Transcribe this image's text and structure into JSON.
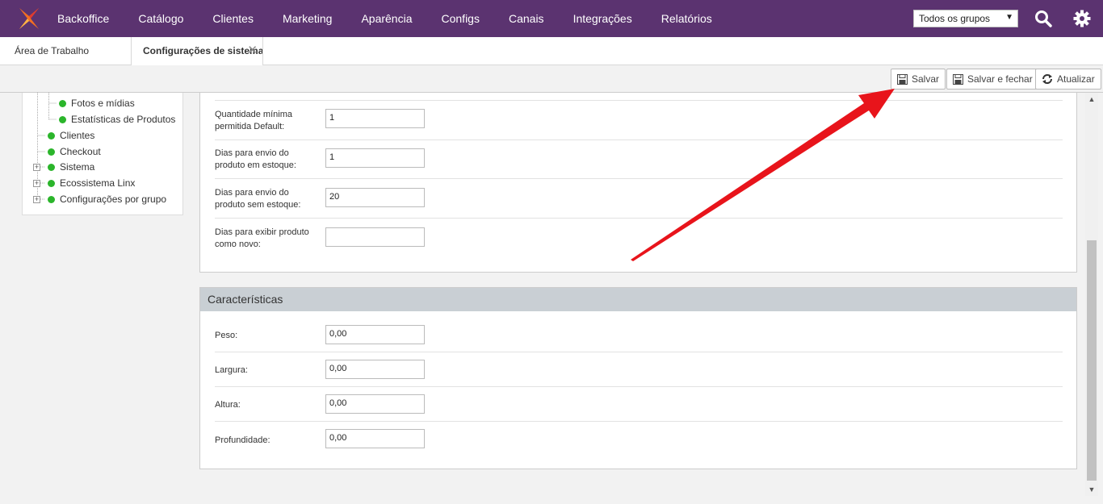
{
  "topnav": {
    "items": [
      "Backoffice",
      "Catálogo",
      "Clientes",
      "Marketing",
      "Aparência",
      "Configs",
      "Canais",
      "Integrações",
      "Relatórios"
    ],
    "group_select": "Todos os grupos",
    "brand_color": "#5b3370"
  },
  "tabs": {
    "home": "Área de Trabalho",
    "active": "Configurações de sistema",
    "close": "✕"
  },
  "toolbar": {
    "save": "Salvar",
    "save_close": "Salvar e fechar",
    "refresh": "Atualizar"
  },
  "tree": {
    "items": [
      "Fotos e mídias",
      "Estatísticas de Produtos",
      "Clientes",
      "Checkout",
      "Sistema",
      "Ecossistema Linx",
      "Configurações por grupo"
    ]
  },
  "panel1": {
    "fields": [
      {
        "label": "Quantidade mínima permitida Default:",
        "value": "1"
      },
      {
        "label": "Dias para envio do produto em estoque:",
        "value": "1"
      },
      {
        "label": "Dias para envio do produto sem estoque:",
        "value": "20"
      },
      {
        "label": "Dias para exibir produto como novo:",
        "value": ""
      }
    ]
  },
  "panel2": {
    "title": "Características",
    "fields": [
      {
        "label": "Peso:",
        "value": "0,00"
      },
      {
        "label": "Largura:",
        "value": "0,00"
      },
      {
        "label": "Altura:",
        "value": "0,00"
      },
      {
        "label": "Profundidade:",
        "value": "0,00"
      }
    ]
  }
}
